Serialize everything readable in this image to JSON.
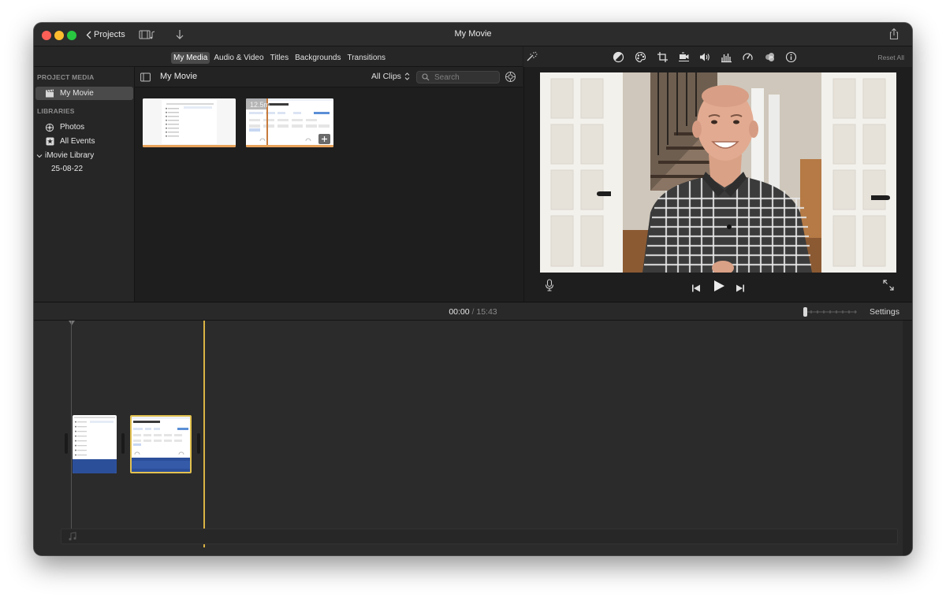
{
  "window": {
    "title": "My Movie",
    "back_label": "Projects"
  },
  "browser": {
    "tabs": [
      "My Media",
      "Audio & Video",
      "Titles",
      "Backgrounds",
      "Transitions"
    ],
    "active_tab": "My Media"
  },
  "sidebar": {
    "project_media_header": "PROJECT MEDIA",
    "project_item": "My Movie",
    "libraries_header": "LIBRARIES",
    "items": [
      {
        "label": "Photos",
        "icon": "photos-icon"
      },
      {
        "label": "All Events",
        "icon": "star-icon"
      },
      {
        "label": "iMovie Library",
        "icon": "chevron-down-icon"
      },
      {
        "label": "25-08-22",
        "icon": ""
      }
    ]
  },
  "media": {
    "title": "My Movie",
    "filter": "All Clips",
    "search_placeholder": "Search",
    "clips": [
      {
        "kind": "screen-recording",
        "duration": ""
      },
      {
        "kind": "screen-recording",
        "duration": "12.5m"
      }
    ]
  },
  "viewer": {
    "reset_label": "Reset All",
    "tools": [
      "magic-wand-icon",
      "color-balance-icon",
      "color-correction-icon",
      "crop-icon",
      "stabilization-icon",
      "volume-icon",
      "equalizer-icon",
      "speed-icon",
      "clip-filter-icon",
      "info-icon"
    ]
  },
  "timeline": {
    "current_time": "00:00",
    "separator": "/",
    "total_time": "15:43",
    "settings_label": "Settings"
  },
  "colors": {
    "window_bg": "#1e1e1e",
    "selection_yellow": "#d9b343",
    "progress_orange": "#e8a35a",
    "clip_blue": "#2c4f9a"
  }
}
